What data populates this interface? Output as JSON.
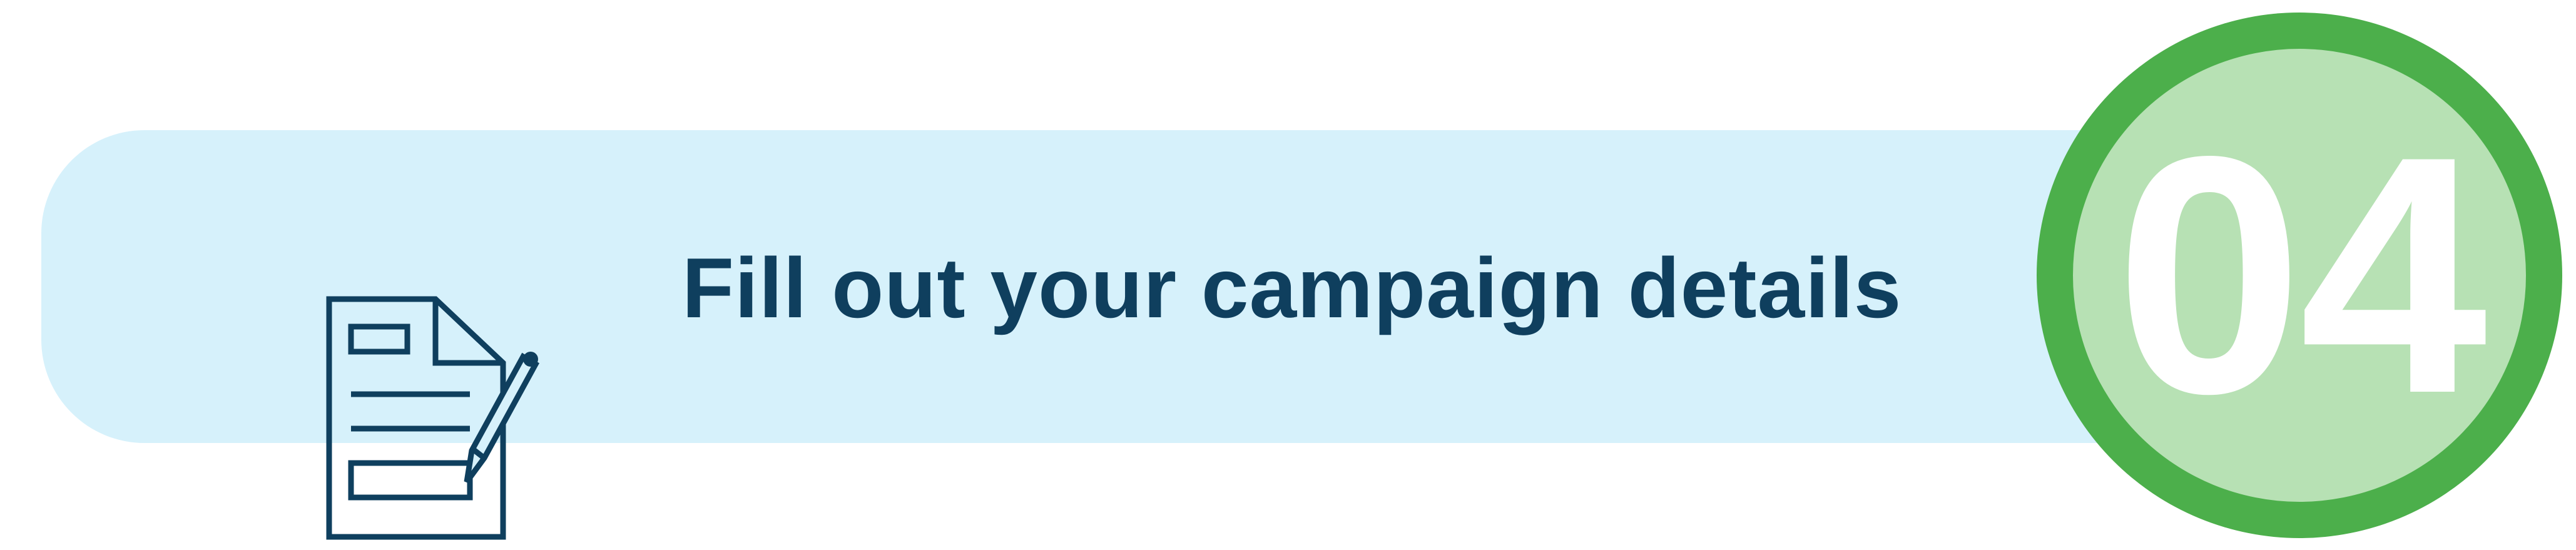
{
  "step": {
    "title": "Fill out your campaign details",
    "number": "04",
    "icon": "document-with-pen-icon"
  },
  "colors": {
    "banner_background": "#d6f1fb",
    "title_text": "#0f3f5e",
    "icon_stroke": "#0f3f5e",
    "badge_ring": "#4caf4b",
    "badge_fill": "#b7e1b4",
    "badge_number": "#ffffff"
  }
}
